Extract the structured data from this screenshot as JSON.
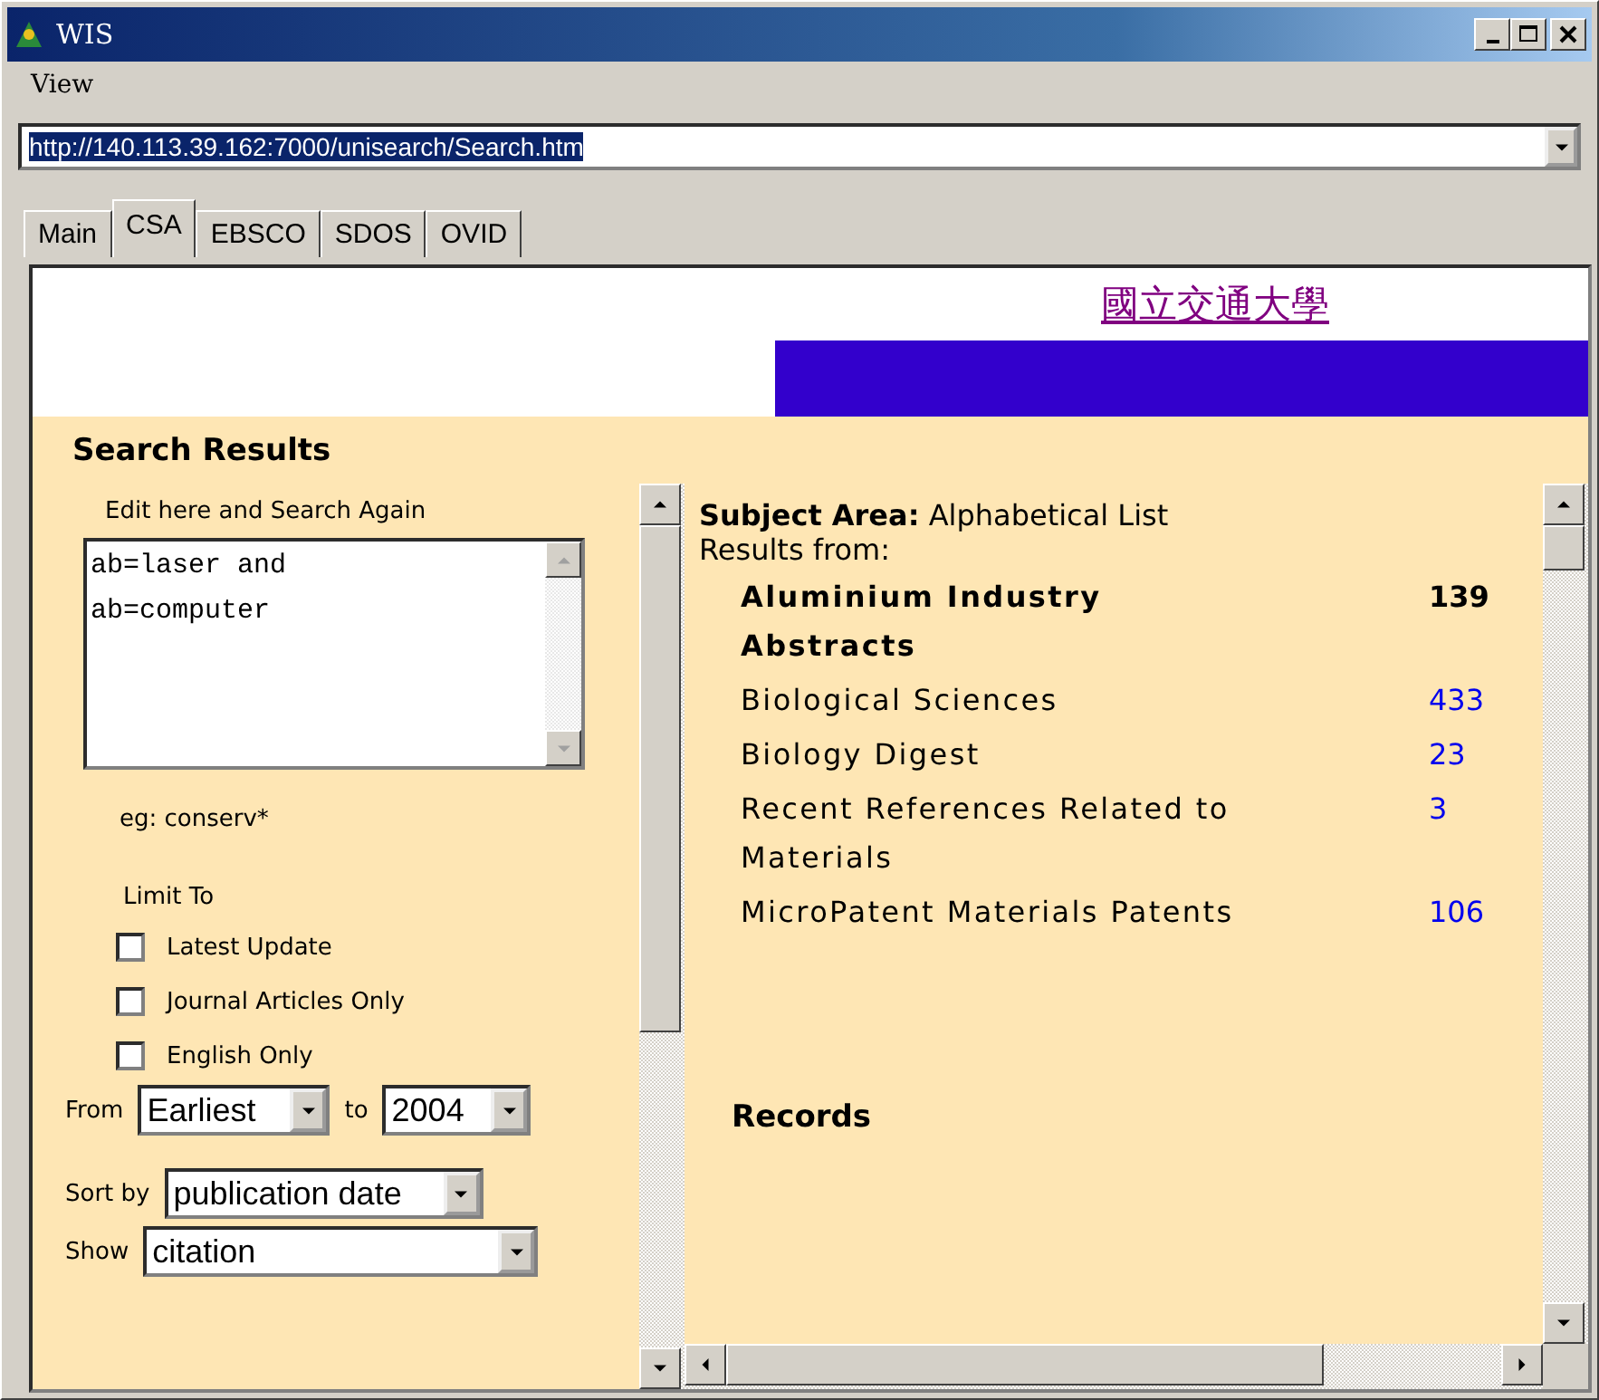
{
  "window": {
    "title": "WIS"
  },
  "menu": [
    "View"
  ],
  "address": {
    "value": "http://140.113.39.162:7000/unisearch/Search.htm"
  },
  "tabs": [
    {
      "label": "Main",
      "selected": false
    },
    {
      "label": "CSA",
      "selected": true
    },
    {
      "label": "EBSCO",
      "selected": false
    },
    {
      "label": "SDOS",
      "selected": false
    },
    {
      "label": "OVID",
      "selected": false
    }
  ],
  "banner": {
    "link": "國立交通大學"
  },
  "search_results": {
    "heading": "Search Results",
    "edit_label": "Edit here and Search Again",
    "query_lines": [
      "ab=laser and",
      "ab=computer"
    ],
    "example": "eg: conserv*",
    "limit_label": "Limit To",
    "limits": [
      {
        "label": "Latest Update",
        "checked": false
      },
      {
        "label": "Journal Articles Only",
        "checked": false
      },
      {
        "label": "English Only",
        "checked": false
      }
    ],
    "from_label": "From",
    "from_value": "Earliest",
    "to_label": "to",
    "to_value": "2004",
    "sort_label": "Sort by",
    "sort_value": "publication date",
    "show_label": "Show",
    "show_value": "citation"
  },
  "results": {
    "subject_label": "Subject Area:",
    "subject_value": "Alphabetical List",
    "results_from": "Results from:",
    "databases": [
      {
        "kind": "current",
        "name": "Aluminium Industry Abstracts",
        "count": "139"
      },
      {
        "kind": "link",
        "name": "Biological Sciences",
        "count": "433"
      },
      {
        "kind": "link",
        "name": "Biology Digest",
        "count": "23"
      },
      {
        "kind": "link",
        "name": "Recent References Related to Materials",
        "count": "3"
      },
      {
        "kind": "link",
        "name": "MicroPatent Materials Patents",
        "count": "106"
      }
    ],
    "records_heading": "Records"
  }
}
